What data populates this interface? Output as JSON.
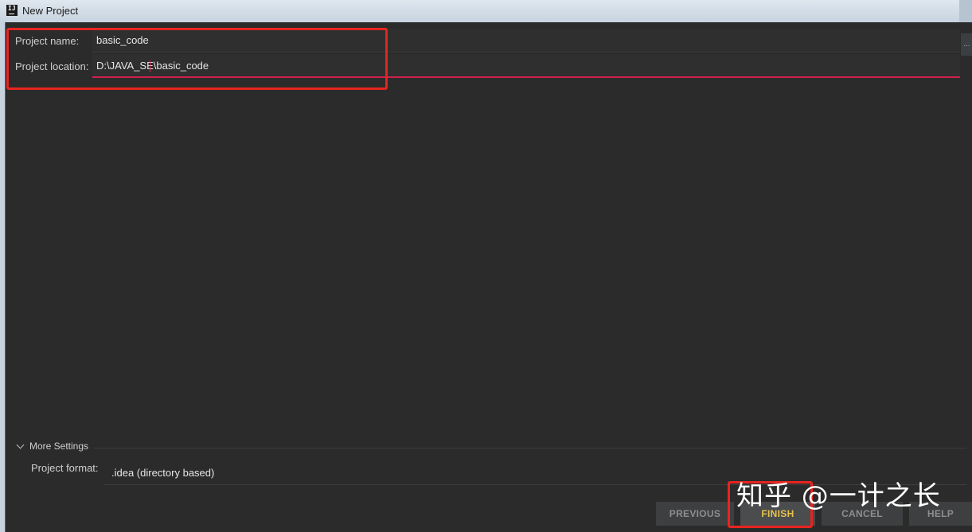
{
  "window": {
    "title": "New Project",
    "app_icon_text": "IJ"
  },
  "form": {
    "project_name_label": "Project name:",
    "project_name_value": "basic_code",
    "project_location_label": "Project location:",
    "project_location_value": "D:\\JAVA_SE\\basic_code",
    "browse_label": "..."
  },
  "more_settings": {
    "toggle_label": "More Settings",
    "project_format_label": "Project format:",
    "project_format_value": ".idea (directory based)"
  },
  "buttons": {
    "previous": "PREVIOUS",
    "finish": "FINISH",
    "cancel": "CANCEL",
    "help": "HELP"
  },
  "watermark": {
    "text": "知乎 @一计之长"
  },
  "colors": {
    "background": "#2b2b2b",
    "highlight": "#e8241f",
    "error_underline": "#d2204e",
    "finish_text": "#e8c34a"
  }
}
